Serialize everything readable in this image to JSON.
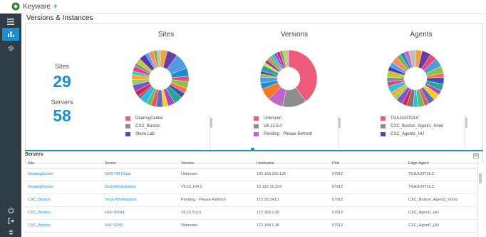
{
  "app": {
    "name": "Keyware",
    "plus": "+"
  },
  "page": {
    "title": "Versions & Instances"
  },
  "stats": {
    "sites_label": "Sites",
    "sites_value": "29",
    "servers_label": "Servers",
    "servers_value": "58"
  },
  "colors": {
    "accent": "#1e8fcd",
    "nav": "#2f3d47",
    "brand": "#3aa84a"
  },
  "nav_icons": [
    "menu-icon",
    "dashboard-icon",
    "settings-icon",
    "power-icon",
    "logout-icon",
    "collapse-icon"
  ],
  "chart_data": [
    {
      "type": "pie",
      "title": "Sites",
      "donut": true,
      "legend": [
        {
          "label": "DearingCenter",
          "color": "#ee5a7a"
        },
        {
          "label": "CXC_Boston",
          "color": "#8d8d8d"
        },
        {
          "label": "Steve Lab",
          "color": "#6a3da0"
        }
      ],
      "values": [
        4,
        6,
        9,
        5,
        3,
        4,
        3,
        3,
        5,
        4,
        3,
        4,
        3,
        3,
        4,
        2,
        3,
        4,
        3,
        3,
        2,
        3,
        2,
        3,
        4,
        2,
        3,
        2,
        2
      ],
      "colors": [
        "#f0a23b",
        "#6a3da0",
        "#4f9be0",
        "#1e8fcd",
        "#e94a7a",
        "#8bc34a",
        "#ff7043",
        "#3f51b5",
        "#26a69a",
        "#ab47bc",
        "#ffca28",
        "#5c6bc0",
        "#ef5350",
        "#66bb6a",
        "#29b6f6",
        "#8d6e63",
        "#d81b60",
        "#7e57c2",
        "#9ccc65",
        "#ffa726",
        "#26c6da",
        "#ec407a",
        "#78909c",
        "#c0ca33",
        "#5e35b1",
        "#42a5f5",
        "#ff8a65",
        "#7cb342",
        "#bdbdbd"
      ]
    },
    {
      "type": "pie",
      "title": "Versions",
      "donut": true,
      "legend": [
        {
          "label": "Unknown",
          "color": "#ee5a7a"
        },
        {
          "label": "V6.12.5.0",
          "color": "#8d8d8d"
        },
        {
          "label": "Pending - Please Refresh",
          "color": "#c665c9"
        }
      ],
      "values": [
        23,
        8,
        5,
        4,
        2,
        2,
        1,
        1,
        2,
        1,
        1,
        1,
        1,
        1,
        1,
        1,
        1,
        1,
        1
      ],
      "colors": [
        "#ee5a7a",
        "#8d8d8d",
        "#c665c9",
        "#f57c22",
        "#1e8fcd",
        "#4f9be0",
        "#8bc34a",
        "#6a3da0",
        "#26a69a",
        "#ffca28",
        "#3f51b5",
        "#ff7043",
        "#66bb6a",
        "#29b6f6",
        "#ab47bc",
        "#d81b60",
        "#78909c",
        "#c0ca33",
        "#bdbdbd"
      ]
    },
    {
      "type": "pie",
      "title": "Agents",
      "donut": true,
      "legend": [
        {
          "label": "TGAJUOTOLC",
          "color": "#ee5a7a"
        },
        {
          "label": "CXC_Boston_Agent1_Kriori",
          "color": "#8d8d8d"
        },
        {
          "label": "CXC_Agent1_HU",
          "color": "#6a3da0"
        }
      ],
      "values": [
        3,
        4,
        3,
        4,
        3,
        2,
        3,
        3,
        2,
        3,
        3,
        2,
        3,
        2,
        3,
        2,
        3,
        2,
        2,
        3,
        2,
        2,
        3,
        2,
        2,
        3,
        2,
        2,
        2,
        3
      ],
      "colors": [
        "#f0a23b",
        "#6a3da0",
        "#e94a7a",
        "#4f9be0",
        "#8bc34a",
        "#ff7043",
        "#3f51b5",
        "#26a69a",
        "#ab47bc",
        "#ffca28",
        "#5c6bc0",
        "#ef5350",
        "#66bb6a",
        "#29b6f6",
        "#8d6e63",
        "#d81b60",
        "#7e57c2",
        "#9ccc65",
        "#ffa726",
        "#26c6da",
        "#ec407a",
        "#78909c",
        "#c0ca33",
        "#5e35b1",
        "#42a5f5",
        "#ff8a65",
        "#7cb342",
        "#1e8fcd",
        "#c665c9",
        "#bdbdbd"
      ]
    }
  ],
  "servers": {
    "title": "Servers",
    "expand_label": "⊞",
    "columns": [
      "Site",
      "Server",
      "Version",
      "Hostname",
      "Port",
      "Edge Agent"
    ],
    "rows": [
      [
        "DearingCenter",
        "NVR VM Clone",
        "Unknown",
        "192.168.150.126",
        "57912",
        "TGAJUOTOLC"
      ],
      [
        "DearingCenter",
        "DemoWorkstation",
        "V6.15.104.0",
        "10.122.15.224",
        "57912",
        "TGAJUOTOLC"
      ],
      [
        "CXC_Boston",
        "Vorvo-Workstation",
        "Pending - Please Refresh",
        "172.28.143.1",
        "57912",
        "CXC_Boston_Agent2_Vorvo"
      ],
      [
        "CXC_Boston",
        "HVP NVR4",
        "V6.12.5.0.0",
        "172.168.1.95",
        "57912",
        "CXC_Agent1_HU"
      ],
      [
        "CXC_Boston",
        "HVP SPIR",
        "Unknown",
        "172.168.1.96",
        "57912",
        "CXC_Agent1_HU"
      ]
    ]
  }
}
